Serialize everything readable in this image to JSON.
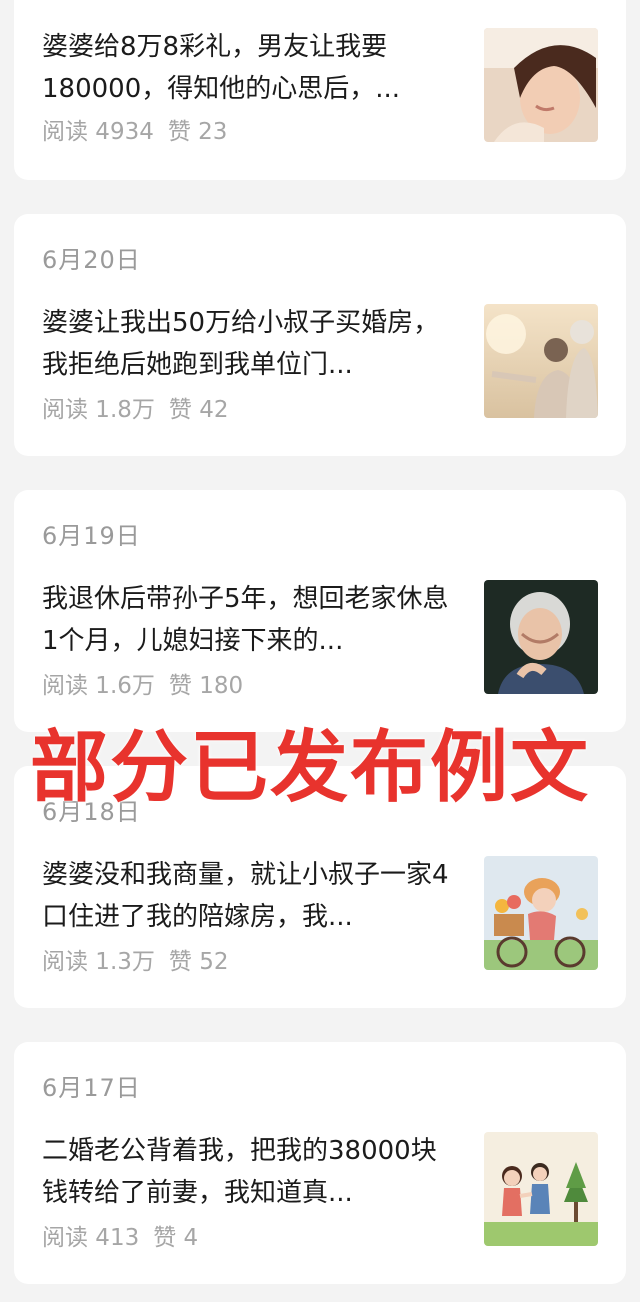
{
  "articles": [
    {
      "date": "",
      "title": "婆婆给8万8彩礼，男友让我要180000，得知他的心思后，...",
      "reads": "阅读 4934",
      "likes": "赞 23",
      "thumb_icon": "woman-crying-photo"
    },
    {
      "date": "6月20日",
      "title": "婆婆让我出50万给小叔子买婚房，我拒绝后她跑到我单位门...",
      "reads": "阅读 1.8万",
      "likes": "赞 42",
      "thumb_icon": "elderly-couple-photo"
    },
    {
      "date": "6月19日",
      "title": "我退休后带孙子5年，想回老家休息1个月，儿媳妇接下来的...",
      "reads": "阅读 1.6万",
      "likes": "赞 180",
      "thumb_icon": "elderly-woman-photo"
    },
    {
      "date": "6月18日",
      "title": "婆婆没和我商量，就让小叔子一家4口住进了我的陪嫁房，我...",
      "reads": "阅读 1.3万",
      "likes": "赞 52",
      "thumb_icon": "grandma-bicycle-illustration"
    },
    {
      "date": "6月17日",
      "title": "二婚老公背着我，把我的38000块钱转给了前妻，我知道真...",
      "reads": "阅读 413",
      "likes": "赞 4",
      "thumb_icon": "couple-walking-illustration"
    }
  ],
  "overlay_text": "部分已发布例文",
  "colors": {
    "accent_green": "#22b35e",
    "overlay_red": "#e8332d"
  }
}
